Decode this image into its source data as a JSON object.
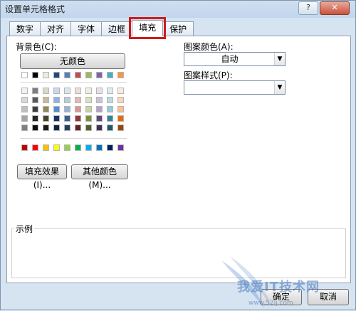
{
  "window": {
    "title": "设置单元格格式"
  },
  "tabs": [
    {
      "label": "数字"
    },
    {
      "label": "对齐"
    },
    {
      "label": "字体"
    },
    {
      "label": "边框"
    },
    {
      "label": "填充",
      "active": true
    },
    {
      "label": "保护"
    }
  ],
  "fill": {
    "background_color_label": "背景色(C):",
    "no_color_button": "无颜色",
    "fill_effects_button": "填充效果(I)...",
    "more_colors_button": "其他颜色(M)...",
    "pattern_color_label": "图案颜色(A):",
    "pattern_color_value": "自动",
    "pattern_style_label": "图案样式(P):",
    "pattern_style_value": "",
    "sample_label": "示例"
  },
  "palette": {
    "theme_row": [
      "#ffffff",
      "#000000",
      "#eeece1",
      "#1f497d",
      "#4f81bd",
      "#c0504d",
      "#9bbb59",
      "#8064a2",
      "#4bacc6",
      "#f79646"
    ],
    "tints": [
      [
        "#f2f2f2",
        "#7f7f7f",
        "#ddd9c3",
        "#c6d9f0",
        "#dbe5f1",
        "#f2dcdb",
        "#ebf1dd",
        "#e5e0ec",
        "#dbeef3",
        "#fdeada"
      ],
      [
        "#d8d8d8",
        "#595959",
        "#c4bd97",
        "#8db3e2",
        "#b8cce4",
        "#e5b9b7",
        "#d7e3bc",
        "#ccc1d9",
        "#b7dde8",
        "#fbd5b5"
      ],
      [
        "#bfbfbf",
        "#3f3f3f",
        "#938953",
        "#548dd4",
        "#95b3d7",
        "#d99694",
        "#c3d69b",
        "#b2a2c7",
        "#92cddc",
        "#fac08f"
      ],
      [
        "#a5a5a5",
        "#262626",
        "#494429",
        "#17365d",
        "#366092",
        "#953734",
        "#76923c",
        "#5f497a",
        "#31859b",
        "#e36c09"
      ],
      [
        "#7f7f7f",
        "#0c0c0c",
        "#1d1b10",
        "#0f243e",
        "#244061",
        "#632423",
        "#4f6128",
        "#3f3151",
        "#205867",
        "#974806"
      ]
    ],
    "standard_row": [
      "#c00000",
      "#ff0000",
      "#ffc000",
      "#ffff00",
      "#92d050",
      "#00b050",
      "#00b0f0",
      "#0070c0",
      "#002060",
      "#7030a0"
    ]
  },
  "footer": {
    "ok_button": "确定",
    "cancel_button": "取消"
  },
  "watermark": {
    "text": "我爱IT技术网",
    "url": "www.52ij.com"
  },
  "title_buttons": {
    "help": "?",
    "close": "✕"
  }
}
